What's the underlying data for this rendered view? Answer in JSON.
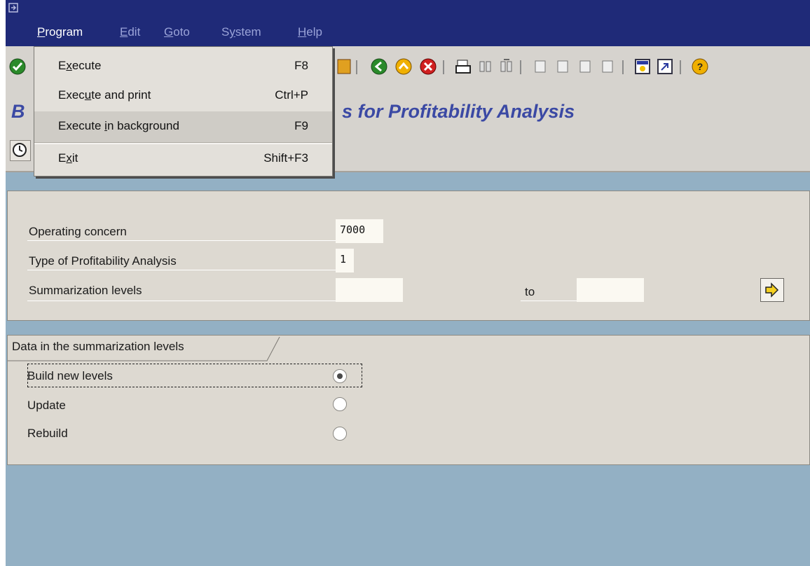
{
  "menubar": {
    "items": [
      {
        "pre": "",
        "u": "P",
        "post": "rogram"
      },
      {
        "pre": "",
        "u": "E",
        "post": "dit"
      },
      {
        "pre": "",
        "u": "G",
        "post": "oto"
      },
      {
        "pre": "S",
        "u": "y",
        "post": "stem"
      },
      {
        "pre": "",
        "u": "H",
        "post": "elp"
      }
    ]
  },
  "dropdown": {
    "items": [
      {
        "pre": "E",
        "u": "x",
        "post": "ecute",
        "shortcut": "F8"
      },
      {
        "pre": "Exec",
        "u": "u",
        "post": "te and print",
        "shortcut": "Ctrl+P"
      },
      {
        "pre": "Execute ",
        "u": "i",
        "post": "n background",
        "shortcut": "F9"
      },
      {
        "pre": "E",
        "u": "x",
        "post": "it",
        "shortcut": "Shift+F3"
      }
    ]
  },
  "title": {
    "left": "B",
    "right": "s for Profitability Analysis"
  },
  "selection": {
    "operating_concern_label": "Operating concern",
    "operating_concern_value": "7000",
    "type_label": "Type of Profitability Analysis",
    "type_value": "1",
    "levels_label": "Summarization levels",
    "levels_from": "",
    "to_label": "to",
    "levels_to": ""
  },
  "radio_group": {
    "title": "Data in the summarization levels",
    "options": [
      {
        "label": "Build new levels",
        "checked": true
      },
      {
        "label": "Update",
        "checked": false
      },
      {
        "label": "Rebuild",
        "checked": false
      }
    ]
  },
  "icons": {
    "system": "system-menu-icon",
    "enter": "enter-icon",
    "save": "save-icon",
    "back": "back-icon",
    "exit": "exit-icon",
    "cancel": "cancel-icon",
    "print": "print-icon",
    "find": "find-icon",
    "find_next": "find-next-icon",
    "first_page": "first-page-icon",
    "prev_page": "previous-page-icon",
    "next_page": "next-page-icon",
    "last_page": "last-page-icon",
    "new_session": "new-session-icon",
    "shortcut": "create-shortcut-icon",
    "help": "help-icon",
    "multiple_selection": "multiple-selection-icon",
    "clock": "execute-background-icon"
  },
  "colors": {
    "menubar": "#1f2a78",
    "title": "#3b49a4",
    "background": "#93b0c4",
    "panel": "#ddd9d1"
  }
}
